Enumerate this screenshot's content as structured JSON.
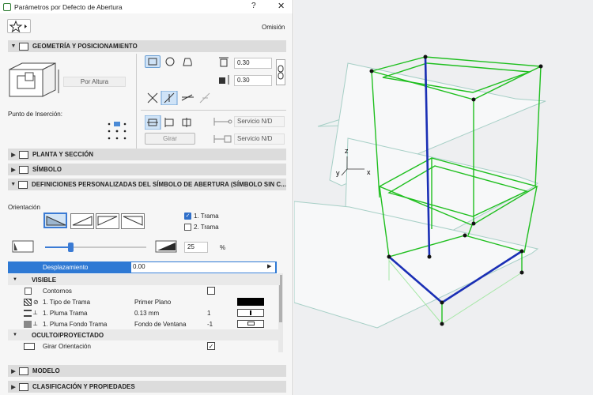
{
  "title": "Parámetros por Defecto de Abertura",
  "titlebar": {
    "help": "?",
    "close": "✕"
  },
  "omision": "Omisión",
  "sections": {
    "geometria": "GEOMETRÍA Y POSICIONAMIENTO",
    "planta": "PLANTA Y SECCIÓN",
    "simbolo": "SÍMBOLO",
    "definiciones": "DEFINICIONES PERSONALIZADAS DEL SÍMBOLO DE ABERTURA (SÍMBOLO SIN C...",
    "modelo": "MODELO",
    "clasificacion": "CLASIFICACIÓN Y PROPIEDADES"
  },
  "geometry": {
    "anchor": "Por Altura",
    "insertion_label": "Punto de Inserción:",
    "width": "0.30",
    "height": "0.30",
    "girar": "Girar",
    "servicio1": "Servicio N/D",
    "servicio2": "Servicio N/D"
  },
  "orientation": {
    "label": "Orientación",
    "trama1": "1. Trama",
    "trama2": "2. Trama",
    "trama1_checked": true,
    "trama2_checked": false,
    "percent_value": "25",
    "percent_unit": "%",
    "slider_fraction": 0.45
  },
  "table": {
    "header_label": "Desplazamiento",
    "header_value": "0.00",
    "visible_group": "VISIBLE",
    "rows": [
      {
        "name": "Contornos",
        "value": "",
        "num": ""
      },
      {
        "name": "1. Tipo de Trama",
        "value": "Primer Plano",
        "num": ""
      },
      {
        "name": "1. Pluma Trama",
        "value": "0.13 mm",
        "num": "1"
      },
      {
        "name": "1. Pluma Fondo Trama",
        "value": "Fondo de Ventana",
        "num": "-1"
      }
    ],
    "hidden_group": "OCULTO/PROYECTADO",
    "girar_orientacion": "Girar Orientación"
  },
  "viewport": {
    "axis_z": "z",
    "axis_y": "y",
    "axis_x": "x"
  },
  "colors": {
    "accent": "#3b7bd4",
    "wire": "#1fbf1f",
    "selected": "#1a2fb5",
    "panel": "#f6f6f6"
  }
}
